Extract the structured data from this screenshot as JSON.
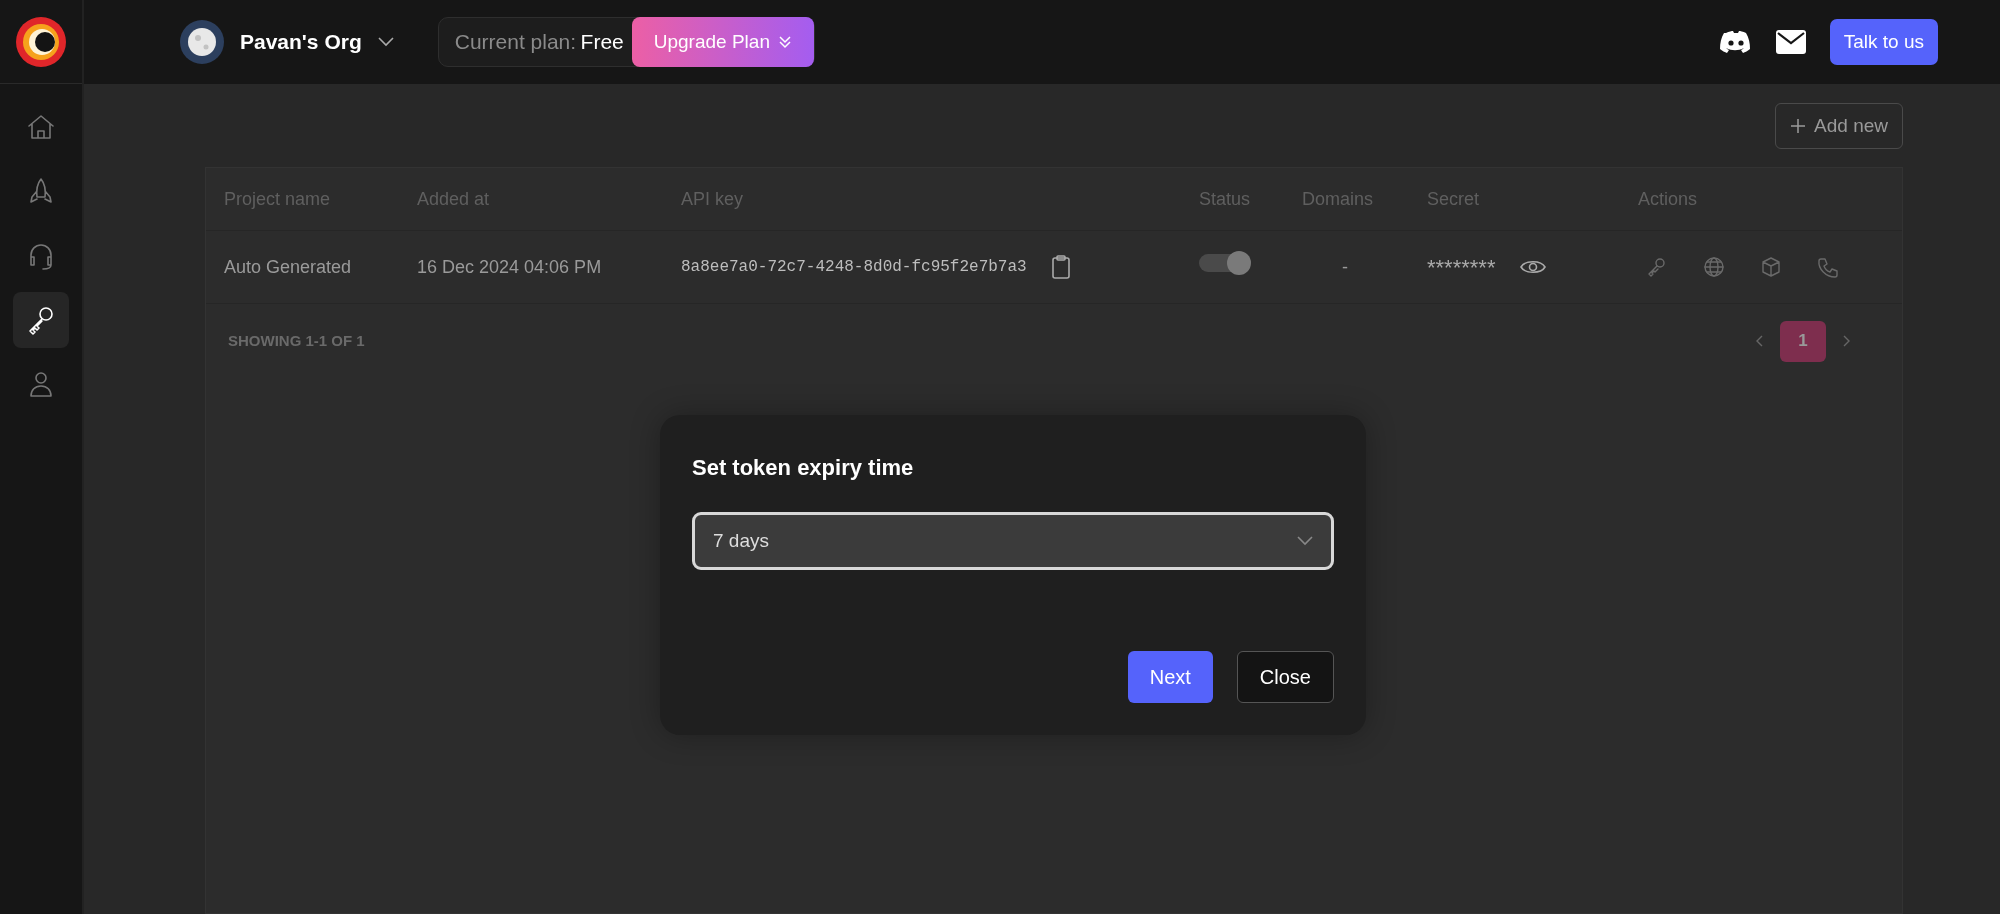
{
  "sidebar": {
    "items": [
      {
        "kind": "home",
        "selected": false
      },
      {
        "kind": "rocket",
        "selected": false
      },
      {
        "kind": "headset",
        "selected": false
      },
      {
        "kind": "key",
        "selected": true
      },
      {
        "kind": "user",
        "selected": false
      }
    ]
  },
  "header": {
    "org_name": "Pavan's Org",
    "plan_label": "Current plan:",
    "plan_value": "Free",
    "upgrade_button": "Upgrade Plan",
    "talk_button": "Talk to us"
  },
  "add_new_button": "Add new",
  "table": {
    "columns": [
      "Project name",
      "Added at",
      "API key",
      "Status",
      "Domains",
      "Secret",
      "Actions"
    ],
    "rows": [
      {
        "project_name": "Auto Generated",
        "added_at": "16 Dec 2024 04:06 PM",
        "api_key": "8a8ee7a0-72c7-4248-8d0d-fc95f2e7b7a3",
        "status_on": true,
        "domains": "-",
        "secret": "********"
      }
    ],
    "footer": "SHOWING 1-1 OF 1",
    "pages": [
      {
        "label": "1",
        "selected": true
      }
    ]
  },
  "modal": {
    "title": "Set token expiry time",
    "select_value": "7 days",
    "buttons": [
      {
        "label": "Next",
        "kind": "primary"
      },
      {
        "label": "Close",
        "kind": "secondary"
      }
    ]
  }
}
